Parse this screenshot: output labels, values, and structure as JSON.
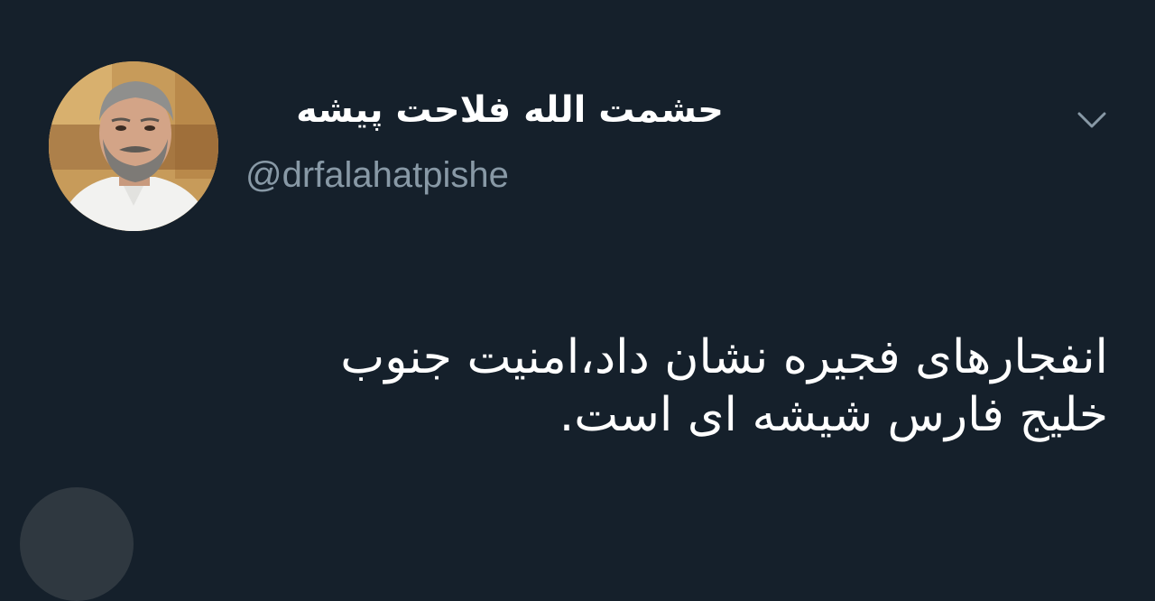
{
  "tweet": {
    "display_name": "حشمت الله فلاحت پیشه",
    "handle": "@drfalahatpishe",
    "text_lines": [
      "انفجارهای فجیره نشان داد،امنیت جنوب",
      "خلیج فارس شیشه ای است."
    ],
    "menu_icon": "chevron-down-icon"
  },
  "colors": {
    "background": "#15202b",
    "name": "#ffffff",
    "handle": "#8899a6",
    "text": "#ffffff"
  }
}
